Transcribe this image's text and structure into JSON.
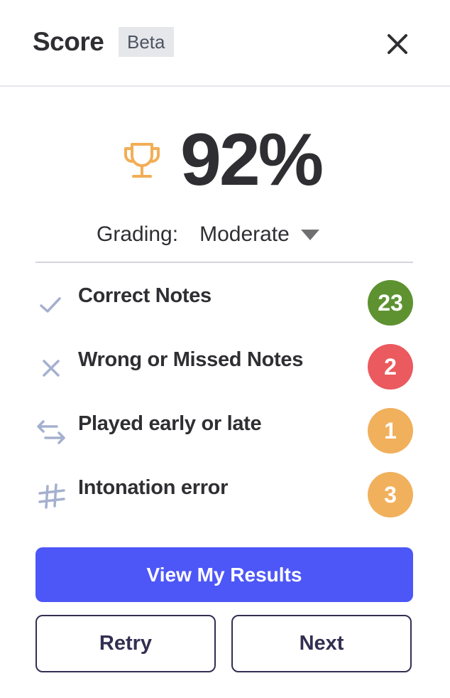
{
  "header": {
    "title": "Score",
    "badge": "Beta",
    "close_icon": "close-icon"
  },
  "score": {
    "icon": "trophy-icon",
    "value": "92%",
    "value_percent": 92,
    "trophy_color": "#f2ae55"
  },
  "grading": {
    "label": "Grading:",
    "selected": "Moderate",
    "icon": "caret-down-icon"
  },
  "stats": [
    {
      "icon": "check-icon",
      "label": "Correct Notes",
      "count": "23",
      "color": "#5e9231"
    },
    {
      "icon": "x-icon",
      "label": "Wrong or Missed Notes",
      "count": "2",
      "color": "#ea5a5e"
    },
    {
      "icon": "arrows-swap-icon",
      "label": "Played early or late",
      "count": "1",
      "color": "#f1b05c"
    },
    {
      "icon": "sharp-icon",
      "label": "Intonation error",
      "count": "3",
      "color": "#f1b05c"
    }
  ],
  "actions": {
    "primary": "View My Results",
    "retry": "Retry",
    "next": "Next",
    "primary_color": "#4d57f7"
  }
}
